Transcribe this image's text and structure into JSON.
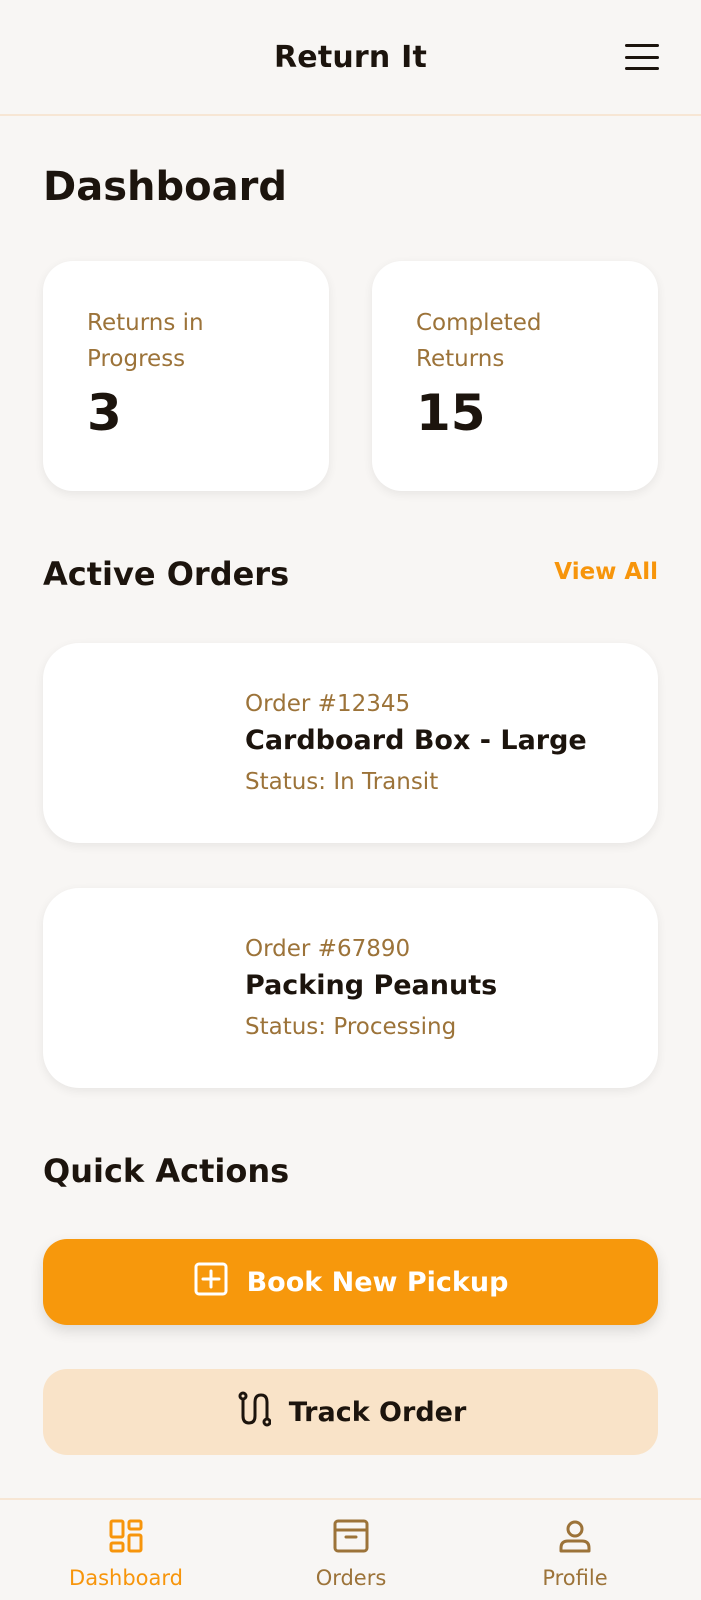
{
  "header": {
    "title": "Return It"
  },
  "page": {
    "title": "Dashboard"
  },
  "stats": [
    {
      "label": "Returns in Progress",
      "value": "3"
    },
    {
      "label": "Completed Returns",
      "value": "15"
    }
  ],
  "active_orders": {
    "title": "Active Orders",
    "view_all_label": "View All",
    "items": [
      {
        "order_id": "Order #12345",
        "name": "Cardboard Box - Large",
        "status": "Status: In Transit"
      },
      {
        "order_id": "Order #67890",
        "name": "Packing Peanuts",
        "status": "Status: Processing"
      }
    ]
  },
  "quick_actions": {
    "title": "Quick Actions",
    "primary_label": "Book New Pickup",
    "primary_icon": "plus-square-icon",
    "secondary_label": "Track Order",
    "secondary_icon": "route-icon"
  },
  "bottom_nav": [
    {
      "label": "Dashboard",
      "icon": "dashboard-icon",
      "active": true
    },
    {
      "label": "Orders",
      "icon": "archive-box-icon",
      "active": false
    },
    {
      "label": "Profile",
      "icon": "person-icon",
      "active": false
    }
  ],
  "colors": {
    "accent": "#f7950b",
    "muted_text": "#9c7339",
    "secondary_button": "#f9e3c8",
    "background": "#f8f6f4"
  }
}
